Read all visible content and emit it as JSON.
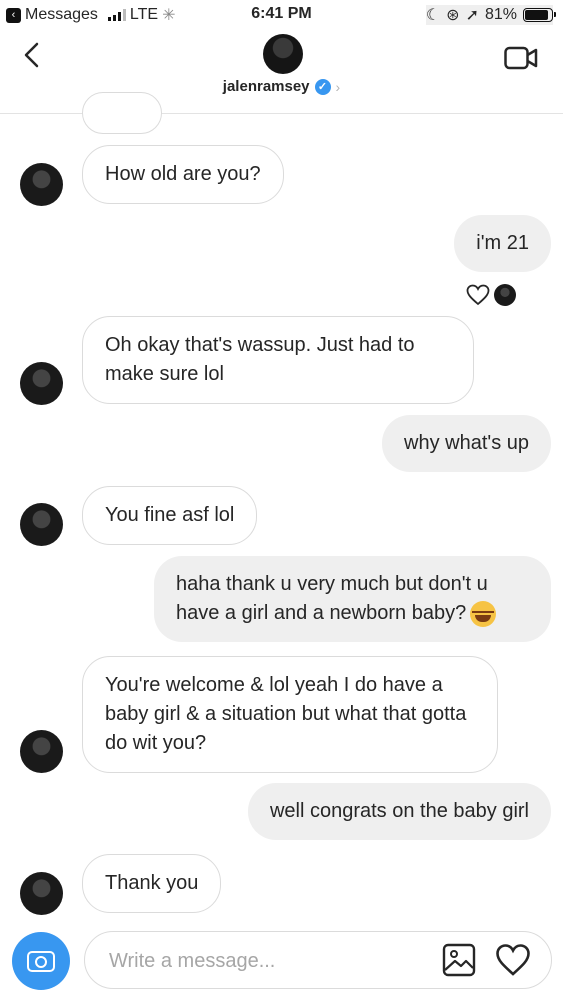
{
  "status_bar": {
    "back_app": "Messages",
    "carrier": "LTE",
    "time": "6:41 PM",
    "battery_percent": "81%",
    "battery_level": 0.81
  },
  "header": {
    "username": "jalenramsey"
  },
  "messages": [
    {
      "text": "How old are you?"
    },
    {
      "text": "i'm 21"
    },
    {
      "text": "Oh okay that's wassup. Just had to make sure lol"
    },
    {
      "text": "why what's up"
    },
    {
      "text": "You fine asf lol"
    },
    {
      "text": "haha thank u very much but don't u have a girl and a newborn baby?"
    },
    {
      "text": "You're welcome & lol yeah I do have a baby girl & a situation but what that gotta do wit you?"
    },
    {
      "text": "well congrats on the baby girl"
    },
    {
      "text": "Thank you"
    }
  ],
  "composer": {
    "placeholder": "Write a message..."
  },
  "icons": {
    "back": "chevron-left-icon",
    "video": "video-call-icon",
    "verified": "verified-badge-icon",
    "camera": "camera-icon",
    "gallery": "gallery-icon",
    "like": "heart-icon"
  },
  "colors": {
    "accent": "#3897f0",
    "sent_bubble": "#efefef",
    "received_border": "#dbdbdb"
  }
}
